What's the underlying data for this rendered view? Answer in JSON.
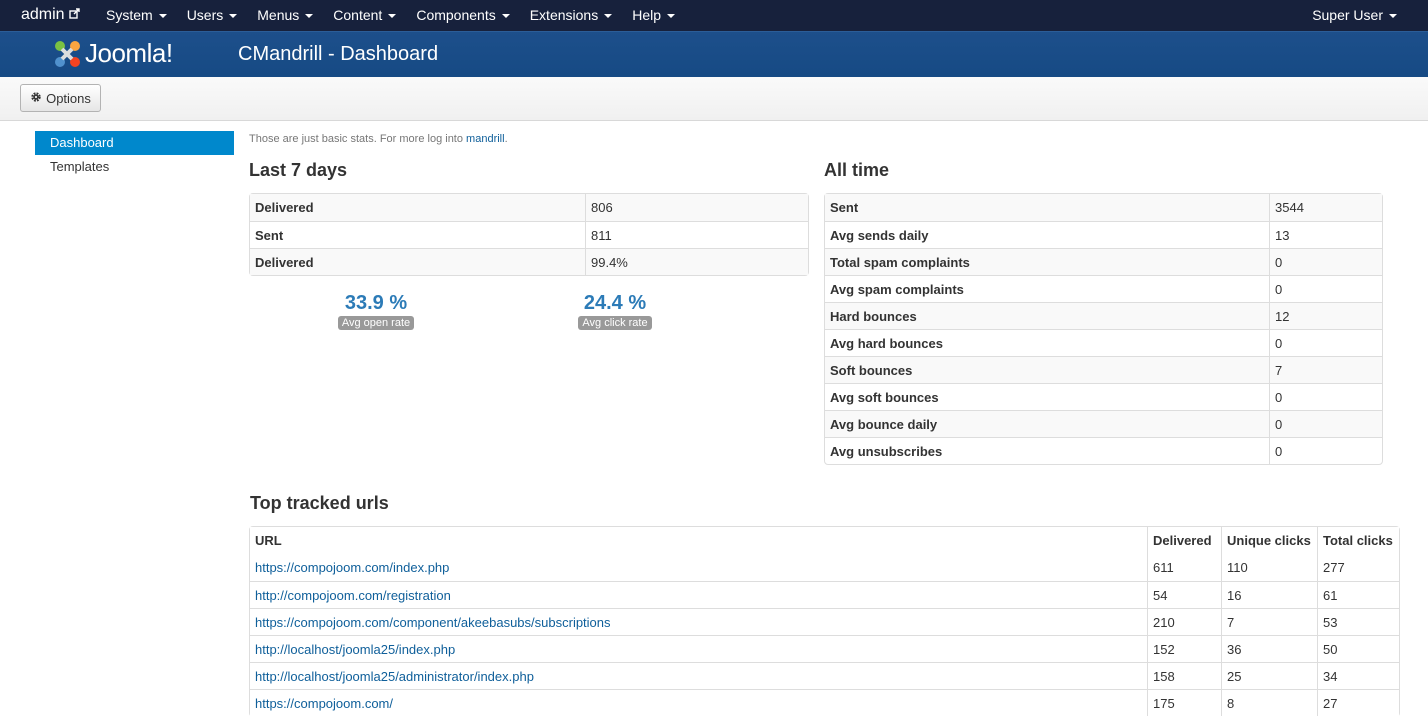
{
  "navbar": {
    "brand": "admin",
    "menu": [
      "System",
      "Users",
      "Menus",
      "Content",
      "Components",
      "Extensions",
      "Help"
    ],
    "user": "Super User"
  },
  "header": {
    "logo_text": "Joomla!",
    "title": "CMandrill - Dashboard"
  },
  "toolbar": {
    "options_label": "Options"
  },
  "sidebar": {
    "items": [
      {
        "label": "Dashboard",
        "active": true
      },
      {
        "label": "Templates",
        "active": false
      }
    ]
  },
  "intro": {
    "text": "Those are just basic stats. For more log into ",
    "link": "mandrill",
    "suffix": "."
  },
  "last7": {
    "title": "Last 7 days",
    "rows": [
      {
        "label": "Delivered",
        "value": "806"
      },
      {
        "label": "Sent",
        "value": "811"
      },
      {
        "label": "Delivered",
        "value": "99.4%"
      }
    ],
    "open_rate": {
      "value": "33.9 %",
      "label": "Avg open rate"
    },
    "click_rate": {
      "value": "24.4 %",
      "label": "Avg click rate"
    }
  },
  "alltime": {
    "title": "All time",
    "rows": [
      {
        "label": "Sent",
        "value": "3544"
      },
      {
        "label": "Avg sends daily",
        "value": "13"
      },
      {
        "label": "Total spam complaints",
        "value": "0"
      },
      {
        "label": "Avg spam complaints",
        "value": "0"
      },
      {
        "label": "Hard bounces",
        "value": "12"
      },
      {
        "label": "Avg hard bounces",
        "value": "0"
      },
      {
        "label": "Soft bounces",
        "value": "7"
      },
      {
        "label": "Avg soft bounces",
        "value": "0"
      },
      {
        "label": "Avg bounce daily",
        "value": "0"
      },
      {
        "label": "Avg unsubscribes",
        "value": "0"
      }
    ]
  },
  "urls": {
    "title": "Top tracked urls",
    "headers": [
      "URL",
      "Delivered",
      "Unique clicks",
      "Total clicks"
    ],
    "rows": [
      {
        "url": "https://compojoom.com/index.php",
        "delivered": "611",
        "unique": "110",
        "total": "277"
      },
      {
        "url": "http://compojoom.com/registration",
        "delivered": "54",
        "unique": "16",
        "total": "61"
      },
      {
        "url": "https://compojoom.com/component/akeebasubs/subscriptions",
        "delivered": "210",
        "unique": "7",
        "total": "53"
      },
      {
        "url": "http://localhost/joomla25/index.php",
        "delivered": "152",
        "unique": "36",
        "total": "50"
      },
      {
        "url": "http://localhost/joomla25/administrator/index.php",
        "delivered": "158",
        "unique": "25",
        "total": "34"
      },
      {
        "url": "https://compojoom.com/",
        "delivered": "175",
        "unique": "8",
        "total": "27"
      }
    ]
  }
}
